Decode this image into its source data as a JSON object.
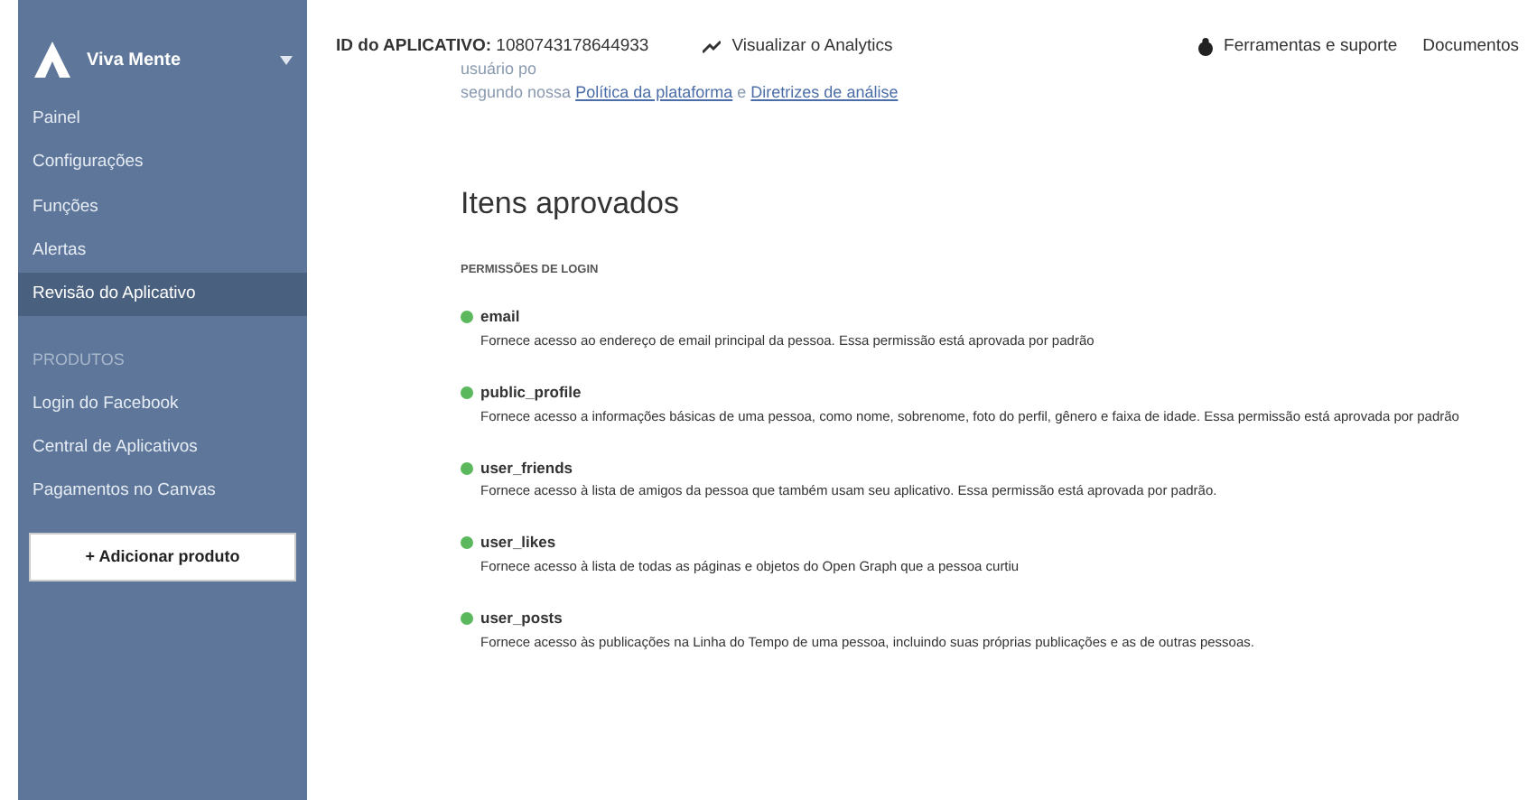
{
  "sidebar": {
    "app_name": "Viva Mente",
    "items": [
      {
        "label": "Painel",
        "selected": false
      },
      {
        "label": "Configurações",
        "selected": false
      },
      {
        "label": "Funções",
        "selected": false
      },
      {
        "label": "Alertas",
        "selected": false
      },
      {
        "label": "Revisão do Aplicativo",
        "selected": true
      }
    ],
    "section": "PRODUTOS",
    "products": [
      {
        "label": "Login do Facebook"
      },
      {
        "label": "Central de Aplicativos"
      },
      {
        "label": "Pagamentos no Canvas"
      }
    ],
    "add_button": "+ Adicionar produto"
  },
  "topbar": {
    "app_id_label": "ID do APLICATIVO:",
    "app_id": "1080743178644933",
    "analytics": "Visualizar o Analytics",
    "tools": "Ferramentas e suporte",
    "docs": "Documentos"
  },
  "intro": {
    "line_1": "usuário po",
    "prefix": "segundo nossa",
    "link_1": "Política da plataforma",
    "separator": "e",
    "link_2": "Diretrizes de análise"
  },
  "title": "Itens aprovados",
  "section_label": "PERMISSÕES DE LOGIN",
  "permissions": [
    {
      "name": "email",
      "description": "Fornece acesso ao endereço de email principal da pessoa. Essa permissão está aprovada por padrão",
      "approved": true
    },
    {
      "name": "public_profile",
      "description": "Fornece acesso a informações básicas de uma pessoa, como nome, sobrenome, foto do perfil, gênero e faixa de idade. Essa permissão está aprovada por padrão",
      "approved": true
    },
    {
      "name": "user_friends",
      "description": "Fornece acesso à lista de amigos da pessoa que também usam seu aplicativo. Essa permissão está aprovada por padrão.",
      "approved": true
    },
    {
      "name": "user_likes",
      "description": "Fornece acesso à lista de todas as páginas e objetos do Open Graph que a pessoa curtiu",
      "approved": true
    },
    {
      "name": "user_posts",
      "description": "Fornece acesso às publicações na Linha do Tempo de uma pessoa, incluindo suas próprias publicações e as de outras pessoas.",
      "approved": true
    }
  ]
}
